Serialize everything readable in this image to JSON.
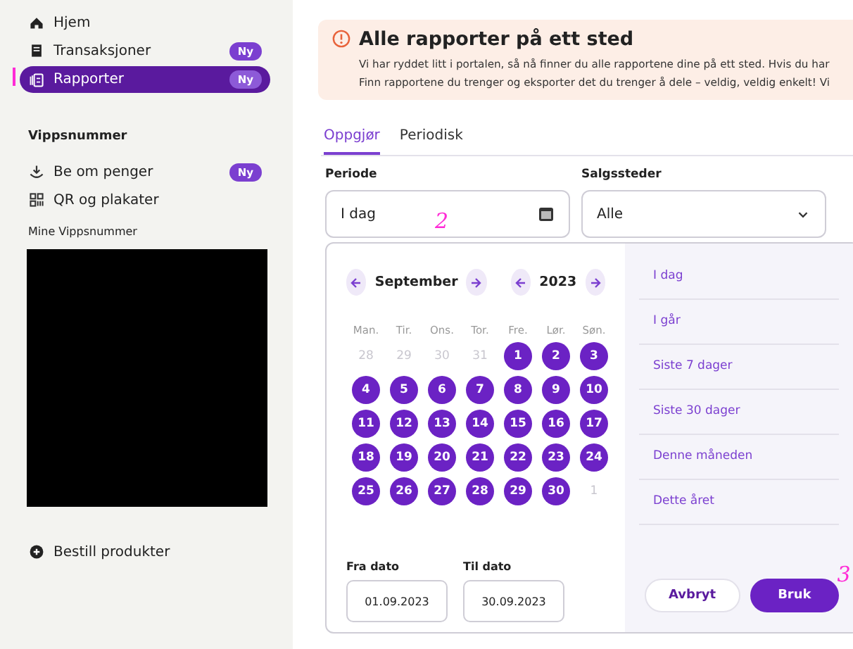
{
  "sidebar": {
    "items": [
      {
        "label": "Hjem",
        "selected": false
      },
      {
        "label": "Transaksjoner",
        "badge": "Ny",
        "selected": false
      },
      {
        "label": "Rapporter",
        "badge": "Ny",
        "selected": true
      }
    ],
    "section_title": "Vippsnummer",
    "section_items": [
      {
        "label": "Be om penger",
        "badge": "Ny",
        "selected": false
      },
      {
        "label": "QR og plakater",
        "selected": false
      }
    ],
    "subsection_title": "Mine Vippsnummer",
    "footer_item": {
      "label": "Bestill produkter"
    }
  },
  "banner": {
    "title": "Alle rapporter på ett sted",
    "lines": [
      "Vi har ryddet litt i portalen, så nå finner du alle rapportene dine på ett sted. Hvis du har",
      "Finn rapportene du trenger og eksporter det du trenger å dele – veldig, veldig enkelt! Vi"
    ]
  },
  "tabs": [
    {
      "label": "Oppgjør",
      "selected": true
    },
    {
      "label": "Periodisk",
      "selected": false
    }
  ],
  "period": {
    "label": "Periode",
    "value": "I dag"
  },
  "sales_points": {
    "label": "Salgssteder",
    "value": "Alle"
  },
  "annotations": [
    "2",
    "3"
  ],
  "datepicker": {
    "month": "September",
    "year": "2023",
    "weekdays": [
      "Man.",
      "Tir.",
      "Ons.",
      "Tor.",
      "Fre.",
      "Lør.",
      "Søn."
    ],
    "days": [
      {
        "label": "28",
        "selected": false
      },
      {
        "label": "29",
        "selected": false
      },
      {
        "label": "30",
        "selected": false
      },
      {
        "label": "31",
        "selected": false
      },
      {
        "label": "1",
        "selected": true
      },
      {
        "label": "2",
        "selected": true
      },
      {
        "label": "3",
        "selected": true
      },
      {
        "label": "4",
        "selected": true
      },
      {
        "label": "5",
        "selected": true
      },
      {
        "label": "6",
        "selected": true
      },
      {
        "label": "7",
        "selected": true
      },
      {
        "label": "8",
        "selected": true
      },
      {
        "label": "9",
        "selected": true
      },
      {
        "label": "10",
        "selected": true
      },
      {
        "label": "11",
        "selected": true
      },
      {
        "label": "12",
        "selected": true
      },
      {
        "label": "13",
        "selected": true
      },
      {
        "label": "14",
        "selected": true
      },
      {
        "label": "15",
        "selected": true
      },
      {
        "label": "16",
        "selected": true
      },
      {
        "label": "17",
        "selected": true
      },
      {
        "label": "18",
        "selected": true
      },
      {
        "label": "19",
        "selected": true
      },
      {
        "label": "20",
        "selected": true
      },
      {
        "label": "21",
        "selected": true
      },
      {
        "label": "22",
        "selected": true
      },
      {
        "label": "23",
        "selected": true
      },
      {
        "label": "24",
        "selected": true
      },
      {
        "label": "25",
        "selected": true
      },
      {
        "label": "26",
        "selected": true
      },
      {
        "label": "27",
        "selected": true
      },
      {
        "label": "28",
        "selected": true
      },
      {
        "label": "29",
        "selected": true
      },
      {
        "label": "30",
        "selected": true
      },
      {
        "label": "1",
        "selected": false
      }
    ],
    "from": {
      "label": "Fra dato",
      "value": "01.09.2023"
    },
    "to": {
      "label": "Til dato",
      "value": "30.09.2023"
    },
    "presets": [
      "I dag",
      "I går",
      "Siste 7 dager",
      "Siste 30 dager",
      "Denne måneden",
      "Dette året"
    ],
    "buttons": [
      {
        "label": "Avbryt",
        "kind": "secondary"
      },
      {
        "label": "Bruk",
        "kind": "primary"
      }
    ]
  }
}
